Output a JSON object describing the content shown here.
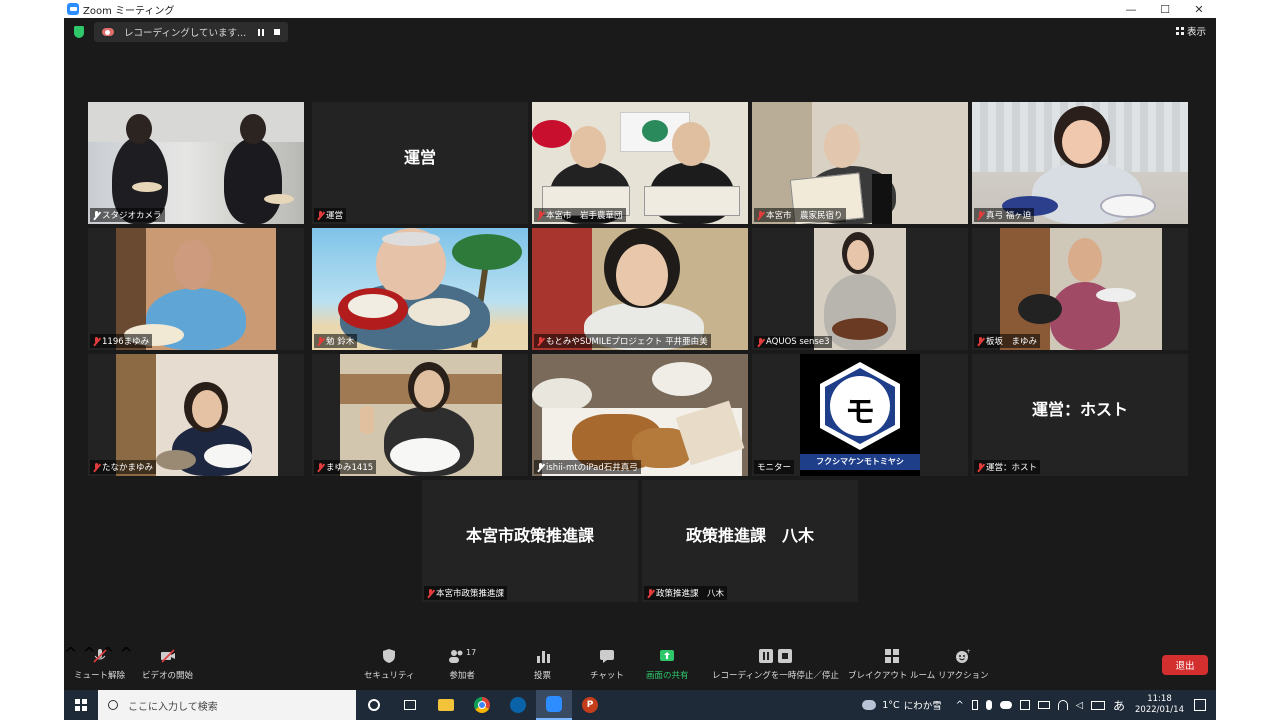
{
  "window": {
    "title": "Zoom ミーティング",
    "controls": [
      "—",
      "☐",
      "✕"
    ]
  },
  "topbar": {
    "recording_text": "レコーディングしています...",
    "view_label": "表示"
  },
  "tiles": [
    {
      "name": "スタジオカメラ",
      "big": ""
    },
    {
      "name": "運営",
      "big": "運営"
    },
    {
      "name": "本宮市　岩手農華団",
      "big": ""
    },
    {
      "name": "本宮市　農家民宿り",
      "big": ""
    },
    {
      "name": "真弓 福ヶ迫",
      "big": ""
    },
    {
      "name": "1196まゆみ",
      "big": ""
    },
    {
      "name": "勉 鈴木",
      "big": ""
    },
    {
      "name": "もとみやSUMILEプロジェクト 平井亜由美",
      "big": ""
    },
    {
      "name": "AQUOS sense3",
      "big": ""
    },
    {
      "name": "板坂　まゆみ",
      "big": ""
    },
    {
      "name": "たなかまゆみ",
      "big": ""
    },
    {
      "name": "まゆみ1415",
      "big": ""
    },
    {
      "name": "ishii-mtのiPad石井真弓",
      "big": ""
    },
    {
      "name": "モニター",
      "big": ""
    },
    {
      "name": "運営：ホスト",
      "big": "運営：ホスト"
    },
    {
      "name": "本宮市政策推進課",
      "big": "本宮市政策推進課"
    },
    {
      "name": "政策推進課　八木",
      "big": "政策推進課　八木"
    }
  ],
  "monitor_logo": {
    "glyph": "モ",
    "caption": "フクシマケンモトミヤシ"
  },
  "toolbar": {
    "mute": "ミュート解除",
    "video": "ビデオの開始",
    "security": "セキュリティ",
    "participants": "参加者",
    "participants_count": "17",
    "polls": "投票",
    "chat": "チャット",
    "share": "画面の共有",
    "record": "レコーディングを一時停止／停止",
    "breakout": "ブレイクアウト ルーム",
    "reactions": "リアクション",
    "leave": "退出"
  },
  "taskbar": {
    "search_placeholder": "ここに入力して検索",
    "weather": "1°C",
    "weather_desc": "にわか雪",
    "ime": "あ",
    "time": "11:18",
    "date": "2022/01/14"
  },
  "colors": {
    "active_speaker": "#c8e35a",
    "share_green": "#2ec76a",
    "leave_red": "#d32f2f",
    "zoom_bg": "#1a1a1a"
  }
}
